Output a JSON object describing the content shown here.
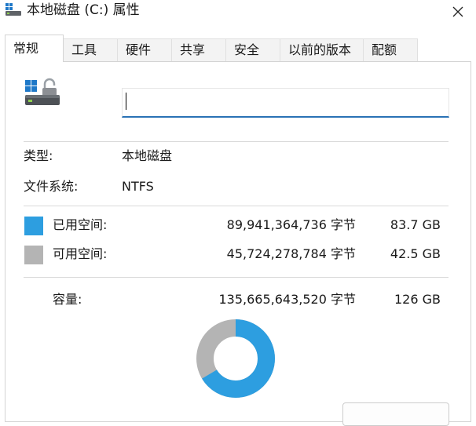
{
  "window": {
    "title": "本地磁盘 (C:) 属性"
  },
  "tabs": [
    {
      "label": "常规",
      "active": true
    },
    {
      "label": "工具",
      "active": false
    },
    {
      "label": "硬件",
      "active": false
    },
    {
      "label": "共享",
      "active": false
    },
    {
      "label": "安全",
      "active": false
    },
    {
      "label": "以前的版本",
      "active": false
    },
    {
      "label": "配额",
      "active": false
    }
  ],
  "general": {
    "volume_name_value": "",
    "type_label": "类型:",
    "type_value": "本地磁盘",
    "filesystem_label": "文件系统:",
    "filesystem_value": "NTFS",
    "used": {
      "label": "已用空间:",
      "bytes": "89,941,364,736 字节",
      "size": "83.7 GB",
      "color": "#2d9ee0"
    },
    "free": {
      "label": "可用空间:",
      "bytes": "45,724,278,784 字节",
      "size": "42.5 GB",
      "color": "#b4b4b4"
    },
    "capacity": {
      "label": "容量:",
      "bytes": "135,665,643,520 字节",
      "size": "126 GB"
    },
    "donut": {
      "used_fraction": 0.663,
      "used_color": "#2d9ee0",
      "free_color": "#b4b4b4"
    }
  },
  "icons": {
    "title": "drive-icon",
    "close": "close-icon",
    "drive": "drive-bitlocker-icon"
  }
}
